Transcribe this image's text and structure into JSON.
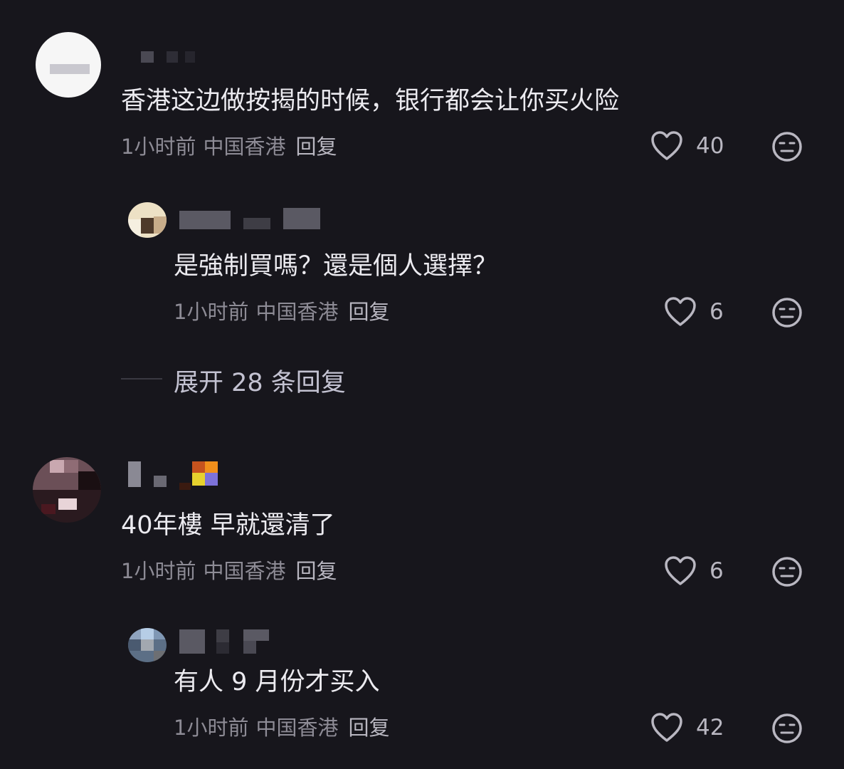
{
  "comments": [
    {
      "text": "香港这边做按揭的时候，银行都会让你买火险",
      "time": "1小时前",
      "location": "中国香港",
      "reply_label": "回复",
      "likes": "40",
      "replies": [
        {
          "text": "是強制買嗎？還是個人選擇？",
          "time": "1小时前",
          "location": "中国香港",
          "reply_label": "回复",
          "likes": "6"
        }
      ],
      "expand_label": "展开 28 条回复"
    },
    {
      "text": "40年樓 早就還清了",
      "time": "1小时前",
      "location": "中国香港",
      "reply_label": "回复",
      "likes": "6",
      "replies": [
        {
          "text": "有人 9 月份才买入",
          "time": "1小时前",
          "location": "中国香港",
          "reply_label": "回复",
          "likes": "42"
        }
      ]
    }
  ],
  "icons": {
    "like": "heart-outline-icon",
    "reaction": "neutral-face-icon"
  },
  "colors": {
    "background": "#17161c",
    "text": "#ecebf0",
    "meta": "#8d8b95"
  }
}
